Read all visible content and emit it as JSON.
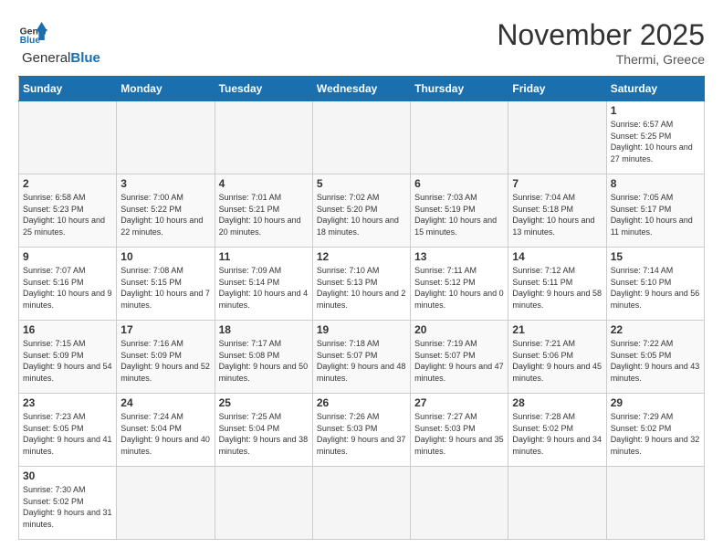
{
  "header": {
    "logo_general": "General",
    "logo_blue": "Blue",
    "month_year": "November 2025",
    "location": "Thermi, Greece"
  },
  "weekdays": [
    "Sunday",
    "Monday",
    "Tuesday",
    "Wednesday",
    "Thursday",
    "Friday",
    "Saturday"
  ],
  "days": [
    {
      "date": "",
      "empty": true
    },
    {
      "date": "",
      "empty": true
    },
    {
      "date": "",
      "empty": true
    },
    {
      "date": "",
      "empty": true
    },
    {
      "date": "",
      "empty": true
    },
    {
      "date": "",
      "empty": true
    },
    {
      "date": "1",
      "sunrise": "6:57 AM",
      "sunset": "5:25 PM",
      "daylight": "10 hours and 27 minutes."
    },
    {
      "date": "2",
      "sunrise": "6:58 AM",
      "sunset": "5:23 PM",
      "daylight": "10 hours and 25 minutes."
    },
    {
      "date": "3",
      "sunrise": "7:00 AM",
      "sunset": "5:22 PM",
      "daylight": "10 hours and 22 minutes."
    },
    {
      "date": "4",
      "sunrise": "7:01 AM",
      "sunset": "5:21 PM",
      "daylight": "10 hours and 20 minutes."
    },
    {
      "date": "5",
      "sunrise": "7:02 AM",
      "sunset": "5:20 PM",
      "daylight": "10 hours and 18 minutes."
    },
    {
      "date": "6",
      "sunrise": "7:03 AM",
      "sunset": "5:19 PM",
      "daylight": "10 hours and 15 minutes."
    },
    {
      "date": "7",
      "sunrise": "7:04 AM",
      "sunset": "5:18 PM",
      "daylight": "10 hours and 13 minutes."
    },
    {
      "date": "8",
      "sunrise": "7:05 AM",
      "sunset": "5:17 PM",
      "daylight": "10 hours and 11 minutes."
    },
    {
      "date": "9",
      "sunrise": "7:07 AM",
      "sunset": "5:16 PM",
      "daylight": "10 hours and 9 minutes."
    },
    {
      "date": "10",
      "sunrise": "7:08 AM",
      "sunset": "5:15 PM",
      "daylight": "10 hours and 7 minutes."
    },
    {
      "date": "11",
      "sunrise": "7:09 AM",
      "sunset": "5:14 PM",
      "daylight": "10 hours and 4 minutes."
    },
    {
      "date": "12",
      "sunrise": "7:10 AM",
      "sunset": "5:13 PM",
      "daylight": "10 hours and 2 minutes."
    },
    {
      "date": "13",
      "sunrise": "7:11 AM",
      "sunset": "5:12 PM",
      "daylight": "10 hours and 0 minutes."
    },
    {
      "date": "14",
      "sunrise": "7:12 AM",
      "sunset": "5:11 PM",
      "daylight": "9 hours and 58 minutes."
    },
    {
      "date": "15",
      "sunrise": "7:14 AM",
      "sunset": "5:10 PM",
      "daylight": "9 hours and 56 minutes."
    },
    {
      "date": "16",
      "sunrise": "7:15 AM",
      "sunset": "5:09 PM",
      "daylight": "9 hours and 54 minutes."
    },
    {
      "date": "17",
      "sunrise": "7:16 AM",
      "sunset": "5:09 PM",
      "daylight": "9 hours and 52 minutes."
    },
    {
      "date": "18",
      "sunrise": "7:17 AM",
      "sunset": "5:08 PM",
      "daylight": "9 hours and 50 minutes."
    },
    {
      "date": "19",
      "sunrise": "7:18 AM",
      "sunset": "5:07 PM",
      "daylight": "9 hours and 48 minutes."
    },
    {
      "date": "20",
      "sunrise": "7:19 AM",
      "sunset": "5:07 PM",
      "daylight": "9 hours and 47 minutes."
    },
    {
      "date": "21",
      "sunrise": "7:21 AM",
      "sunset": "5:06 PM",
      "daylight": "9 hours and 45 minutes."
    },
    {
      "date": "22",
      "sunrise": "7:22 AM",
      "sunset": "5:05 PM",
      "daylight": "9 hours and 43 minutes."
    },
    {
      "date": "23",
      "sunrise": "7:23 AM",
      "sunset": "5:05 PM",
      "daylight": "9 hours and 41 minutes."
    },
    {
      "date": "24",
      "sunrise": "7:24 AM",
      "sunset": "5:04 PM",
      "daylight": "9 hours and 40 minutes."
    },
    {
      "date": "25",
      "sunrise": "7:25 AM",
      "sunset": "5:04 PM",
      "daylight": "9 hours and 38 minutes."
    },
    {
      "date": "26",
      "sunrise": "7:26 AM",
      "sunset": "5:03 PM",
      "daylight": "9 hours and 37 minutes."
    },
    {
      "date": "27",
      "sunrise": "7:27 AM",
      "sunset": "5:03 PM",
      "daylight": "9 hours and 35 minutes."
    },
    {
      "date": "28",
      "sunrise": "7:28 AM",
      "sunset": "5:02 PM",
      "daylight": "9 hours and 34 minutes."
    },
    {
      "date": "29",
      "sunrise": "7:29 AM",
      "sunset": "5:02 PM",
      "daylight": "9 hours and 32 minutes."
    },
    {
      "date": "30",
      "sunrise": "7:30 AM",
      "sunset": "5:02 PM",
      "daylight": "9 hours and 31 minutes."
    },
    {
      "date": "",
      "empty": true
    },
    {
      "date": "",
      "empty": true
    },
    {
      "date": "",
      "empty": true
    },
    {
      "date": "",
      "empty": true
    },
    {
      "date": "",
      "empty": true
    },
    {
      "date": "",
      "empty": true
    }
  ]
}
